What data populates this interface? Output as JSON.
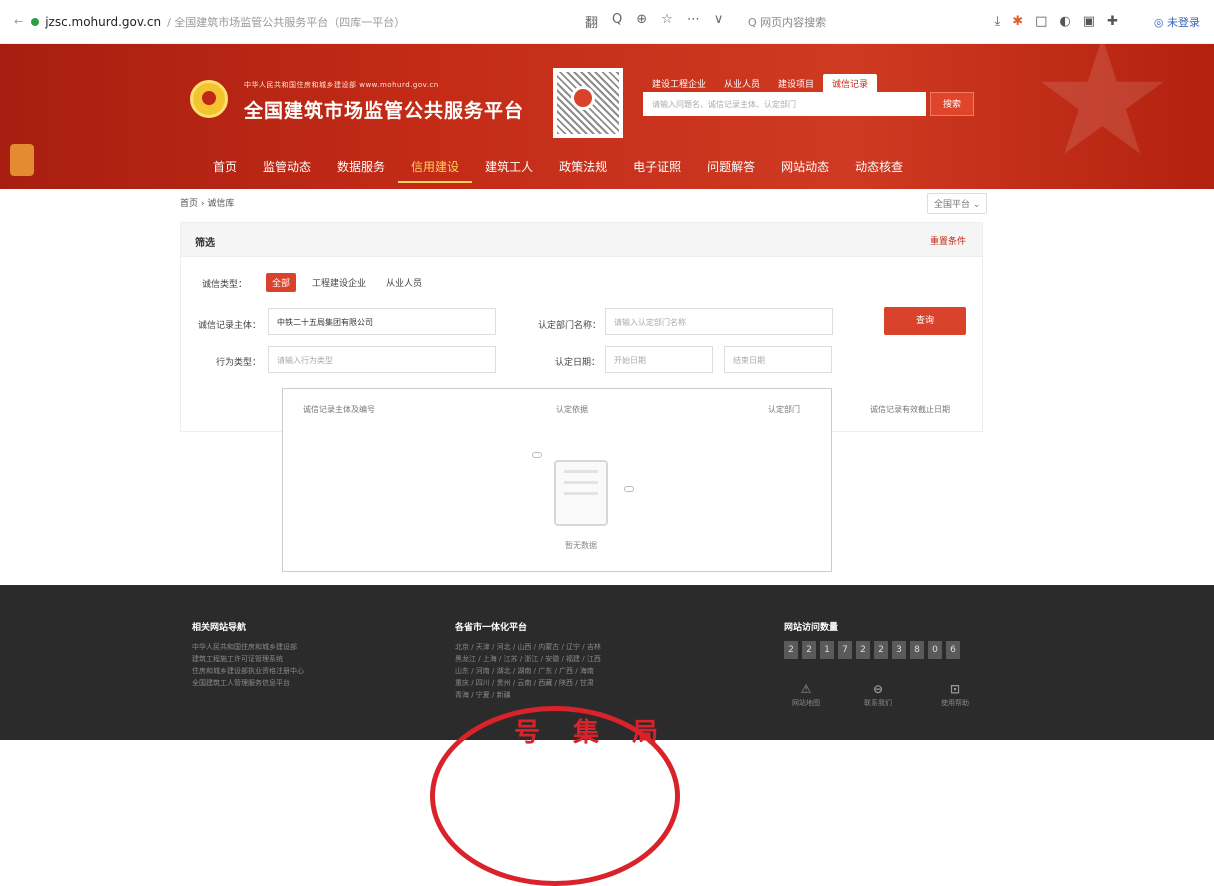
{
  "browser": {
    "url": "jzsc.mohurd.gov.cn",
    "title": "/ 全国建筑市场监管公共服务平台（四库一平台）",
    "toolbar_icons": [
      "翻",
      "Q",
      "⊕",
      "☆",
      "⋯",
      "∨"
    ],
    "search_placeholder": "Q 网页内容搜索",
    "right_icons": [
      "⤓",
      "✱",
      "□",
      "◐",
      "▣",
      "✚"
    ],
    "user_label": "◎ 未登录"
  },
  "header": {
    "ministry_text": "中华人民共和国住房和城乡建设部   www.mohurd.gov.cn",
    "platform_title": "全国建筑市场监管公共服务平台",
    "search_tabs": [
      "建设工程企业",
      "从业人员",
      "建设项目",
      "诚信记录"
    ],
    "search_tabs_active_index": 3,
    "search_placeholder": "请输入问题名、诚信记录主体、认定部门",
    "search_button": "搜索",
    "nav": [
      "首页",
      "监管动态",
      "数据服务",
      "信用建设",
      "建筑工人",
      "政策法规",
      "电子证照",
      "问题解答",
      "网站动态",
      "动态核查"
    ],
    "nav_active_index": 3
  },
  "breadcrumb": "首页  ›  诚信库",
  "breadcrumb_right": "全国平台 ⌄",
  "filter": {
    "title": "筛选",
    "reset_label": "重置条件",
    "type_label": "诚信类型：",
    "types": [
      "全部",
      "工程建设企业",
      "从业人员"
    ],
    "types_active_index": 0,
    "subject_label": "诚信记录主体：",
    "subject_value": "中铁二十五局集团有限公司",
    "dept_label": "认定部门名称：",
    "dept_placeholder": "请输入认定部门名称",
    "behavior_label": "行为类型：",
    "behavior_placeholder": "请输入行为类型",
    "date_label": "认定日期：",
    "date_start_placeholder": "开始日期",
    "date_end_placeholder": "结束日期",
    "query_button": "查询"
  },
  "results": {
    "columns": [
      "诚信记录主体及编号",
      "认定依据",
      "认定部门",
      "诚信记录有效截止日期"
    ],
    "empty_text": "暂无数据"
  },
  "footer": {
    "links_title": "相关网站导航",
    "links": [
      "中华人民共和国住房和城乡建设部",
      "建筑工程施工许可证管理系统",
      "住房和城乡建设部执业资格注册中心",
      "全国建筑工人管理服务信息平台"
    ],
    "provinces_title": "各省市一体化平台",
    "provinces": [
      "北京 / 天津 / 河北 / 山西 / 内蒙古 / 辽宁 / 吉林",
      "黑龙江 / 上海 / 江苏 / 浙江 / 安徽 / 福建 / 江西",
      "山东 / 河南 / 湖北 / 湖南 / 广东 / 广西 / 海南",
      "重庆 / 四川 / 贵州 / 云南 / 西藏 / 陕西 / 甘肃",
      "青海 / 宁夏 / 新疆"
    ],
    "visits_title": "网站访问数量",
    "visit_digits": [
      "2",
      "2",
      "1",
      "7",
      "2",
      "2",
      "3",
      "8",
      "0",
      "6"
    ],
    "bottom_icons": [
      {
        "glyph": "⚠",
        "label": "网站地图"
      },
      {
        "glyph": "⊖",
        "label": "联系我们"
      },
      {
        "glyph": "⊡",
        "label": "使用帮助"
      }
    ]
  },
  "stamp_text": "号 集 局",
  "colors": {
    "brand_red": "#c32b17",
    "accent_yellow": "#ffd15a",
    "button_red": "#d9432b",
    "footer_bg": "#2b2b2b"
  }
}
